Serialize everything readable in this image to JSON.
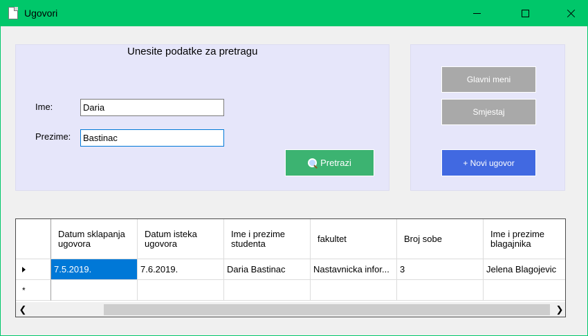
{
  "window": {
    "title": "Ugovori"
  },
  "search": {
    "heading": "Unesite podatke za pretragu",
    "ime_label": "Ime:",
    "ime_value": "Daria",
    "prezime_label": "Prezime:",
    "prezime_value": "Bastinac",
    "search_button": "Pretrazi"
  },
  "actions": {
    "main_menu_button": "Glavni meni",
    "room_button": "Smjestaj",
    "new_contract_button": "+ Novi ugovor"
  },
  "grid": {
    "columns": [
      "Datum sklapanja ugovora",
      "Datum isteka ugovora",
      "Ime i prezime studenta",
      "fakultet",
      "Broj sobe",
      "Ime i prezime blagajnika"
    ],
    "rows": [
      [
        "7.5.2019.",
        "7.6.2019.",
        "Daria Bastinac",
        "Nastavnicka infor...",
        "3",
        "Jelena Blagojevic"
      ]
    ],
    "new_row_marker": "*"
  },
  "colors": {
    "titlebar": "#00c76a",
    "panel": "#e6e6fa",
    "search_button": "#3cb371",
    "new_button": "#4169e1",
    "gray_button": "#a9a9a9",
    "selection": "#0078d7"
  }
}
